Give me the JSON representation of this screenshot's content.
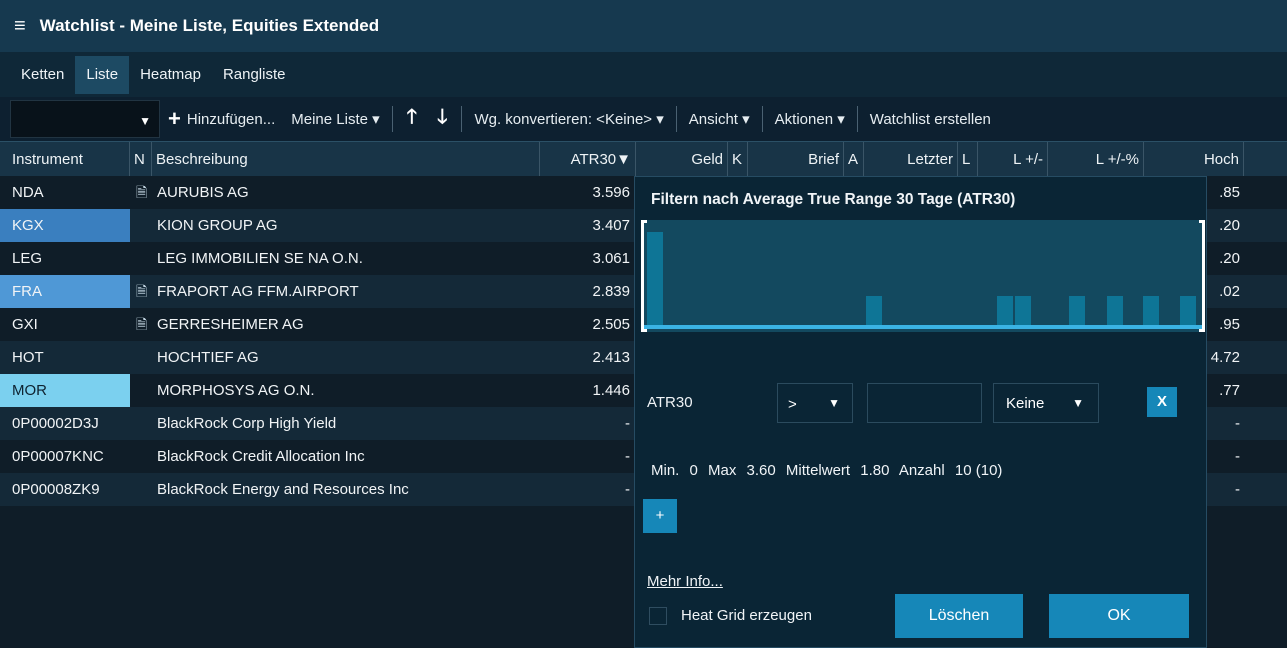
{
  "window": {
    "title": "Watchlist - Meine Liste, Equities Extended"
  },
  "tabs": [
    {
      "label": "Ketten"
    },
    {
      "label": "Liste",
      "active": true
    },
    {
      "label": "Heatmap"
    },
    {
      "label": "Rangliste"
    }
  ],
  "toolbar": {
    "add_label": "Hinzufügen...",
    "list_label": "Meine Liste ▾",
    "convert_label": "Wg. konvertieren: <Keine> ▾",
    "view_label": "Ansicht ▾",
    "actions_label": "Aktionen ▾",
    "create_label": "Watchlist erstellen"
  },
  "columns": {
    "instrument": "Instrument",
    "n": "N",
    "description": "Beschreibung",
    "atr30": "ATR30▼",
    "geld": "Geld",
    "k": "K",
    "brief": "Brief",
    "a": "A",
    "letzter": "Letzter",
    "l": "L",
    "l_abs": "L +/-",
    "l_pct": "L +/-%",
    "hoch": "Hoch"
  },
  "rows": [
    {
      "instrument": "NDA",
      "note": "🗎",
      "description": "AURUBIS AG",
      "atr30": "3.596",
      "hoch": ".85"
    },
    {
      "instrument": "KGX",
      "note": "",
      "description": "KION GROUP AG",
      "atr30": "3.407",
      "hoch": ".20"
    },
    {
      "instrument": "LEG",
      "note": "",
      "description": "LEG IMMOBILIEN SE NA O.N.",
      "atr30": "3.061",
      "hoch": ".20"
    },
    {
      "instrument": "FRA",
      "note": "🗎",
      "description": "FRAPORT AG FFM.AIRPORT",
      "atr30": "2.839",
      "hoch": ".02"
    },
    {
      "instrument": "GXI",
      "note": "🗎",
      "description": "GERRESHEIMER AG",
      "atr30": "2.505",
      "hoch": ".95"
    },
    {
      "instrument": "HOT",
      "note": "",
      "description": "HOCHTIEF AG",
      "atr30": "2.413",
      "hoch": "4.72"
    },
    {
      "instrument": "MOR",
      "note": "",
      "description": "MORPHOSYS AG O.N.",
      "atr30": "1.446",
      "hoch": ".77"
    },
    {
      "instrument": "0P00002D3J",
      "note": "",
      "description": "BlackRock Corp High Yield",
      "atr30": "-",
      "hoch": "-"
    },
    {
      "instrument": "0P00007KNC",
      "note": "",
      "description": "BlackRock Credit Allocation Inc",
      "atr30": "-",
      "hoch": "-"
    },
    {
      "instrument": "0P00008ZK9",
      "note": "",
      "description": "BlackRock Energy and Resources Inc",
      "atr30": "-",
      "hoch": "-"
    }
  ],
  "filter_popup": {
    "title": "Filtern nach Average True Range 30 Tage (ATR30)",
    "field_label": "ATR30",
    "operator": ">",
    "value": "",
    "unit": "Keine",
    "clear_label": "X",
    "stats": {
      "min_label": "Min.",
      "min": "0",
      "max_label": "Max",
      "max": "3.60",
      "mean_label": "Mittelwert",
      "mean": "1.80",
      "count_label": "Anzahl",
      "count": "10 (10)"
    },
    "add_label": "+",
    "more_info_label": "Mehr Info...",
    "heatgrid_label": "Heat Grid erzeugen",
    "heatgrid_checked": false,
    "delete_label": "Löschen",
    "ok_label": "OK"
  },
  "colors": {
    "accent": "#1687b8",
    "histogram_bar": "#0e7596",
    "histogram_bg": "#13495f"
  }
}
